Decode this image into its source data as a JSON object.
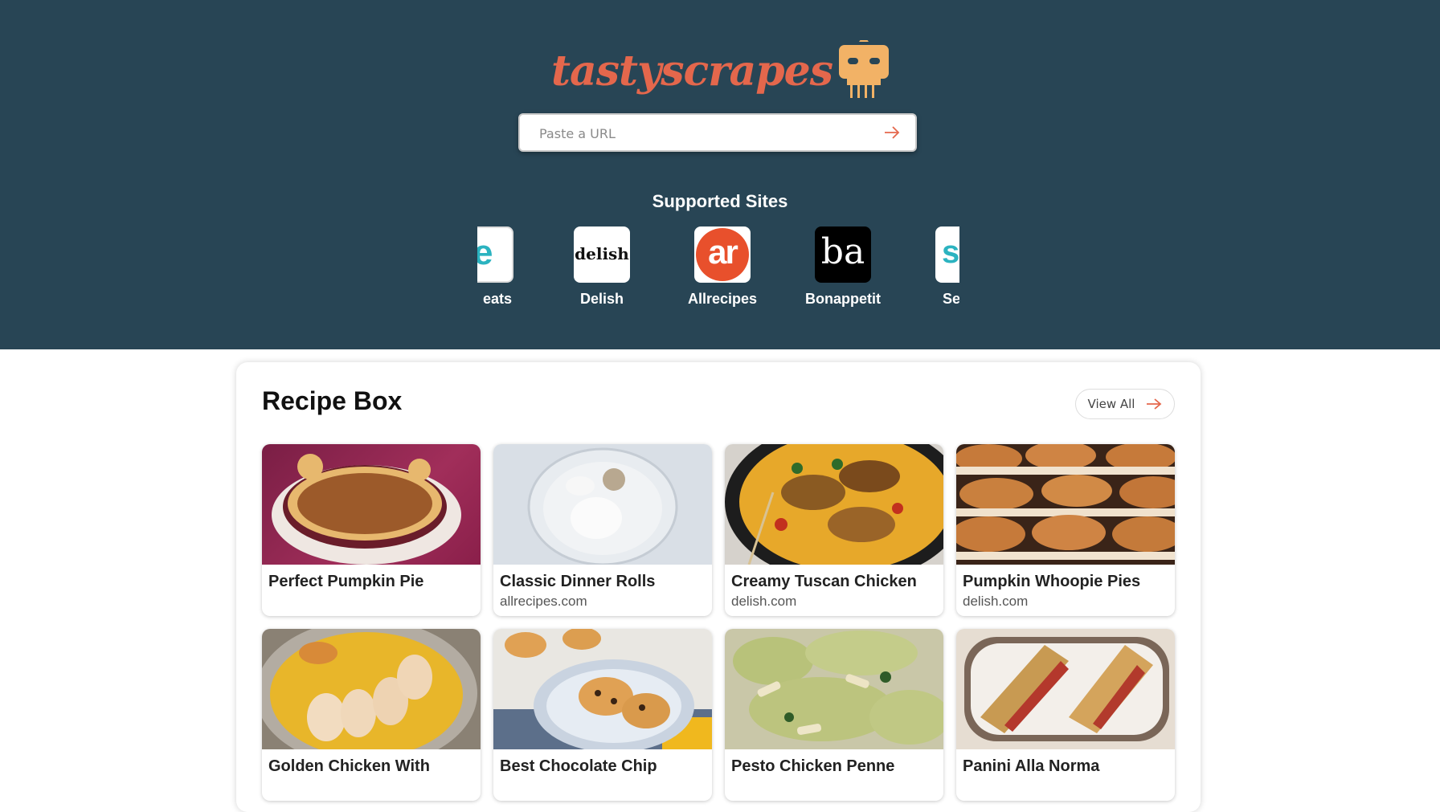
{
  "brand": {
    "name": "tastyscrapes"
  },
  "search": {
    "placeholder": "Paste a URL"
  },
  "supported": {
    "title": "Supported Sites",
    "sites": [
      {
        "name": "eats",
        "logo_text": "e",
        "logo_bg": "#ffffff",
        "logo_color": "#2bb3c0"
      },
      {
        "name": "Delish",
        "logo_text": "delish",
        "logo_bg": "#ffffff",
        "logo_color": "#111111"
      },
      {
        "name": "Allrecipes",
        "logo_text": "ar",
        "logo_bg": "#e8502c",
        "logo_color": "#ffffff"
      },
      {
        "name": "Bonappetit",
        "logo_text": "ba",
        "logo_bg": "#000000",
        "logo_color": "#ffffff"
      },
      {
        "name": "Serious",
        "logo_text": "se",
        "logo_bg": "#ffffff",
        "logo_color": "#2bb3c0"
      }
    ]
  },
  "recipe_box": {
    "title": "Recipe Box",
    "view_all": "View All",
    "recipes": [
      {
        "title": "Perfect Pumpkin Pie",
        "source": ""
      },
      {
        "title": "Classic Dinner Rolls",
        "source": "allrecipes.com"
      },
      {
        "title": "Creamy Tuscan Chicken",
        "source": "delish.com"
      },
      {
        "title": "Pumpkin Whoopie Pies",
        "source": "delish.com"
      },
      {
        "title": "Golden Chicken With",
        "source": ""
      },
      {
        "title": "Best Chocolate Chip",
        "source": ""
      },
      {
        "title": "Pesto Chicken Penne",
        "source": ""
      },
      {
        "title": "Panini Alla Norma",
        "source": ""
      }
    ]
  },
  "colors": {
    "hero_bg": "#284555",
    "accent": "#e4674c",
    "robot": "#f2b266"
  }
}
